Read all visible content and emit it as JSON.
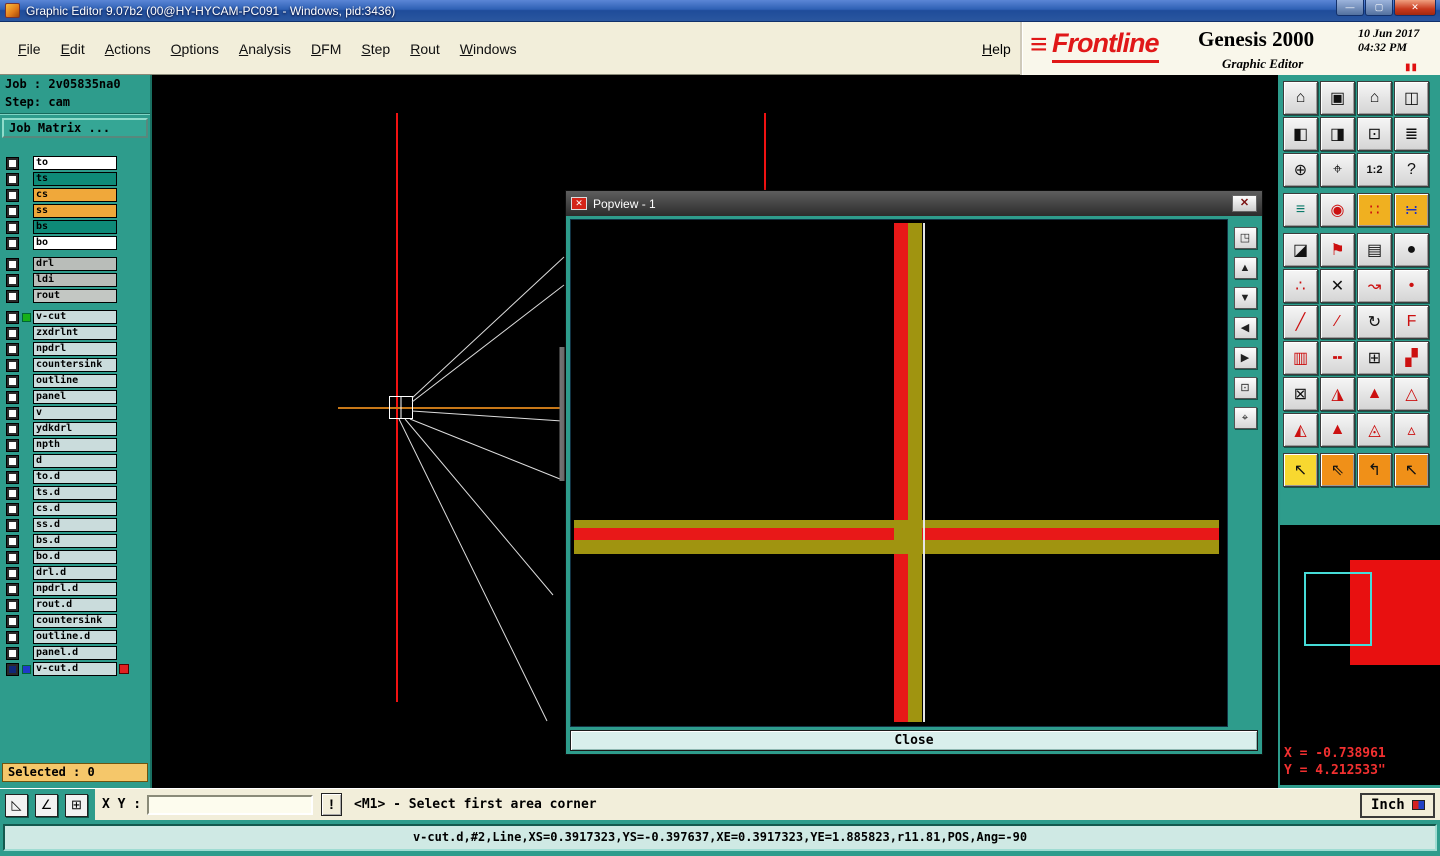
{
  "colors": {
    "accent_teal": "#2e9c8c",
    "canvas_red": "#f01212",
    "canvas_orange": "#c87818",
    "popview_olive": "#a09410",
    "popview_red": "#e81818",
    "coord_red": "#f23030",
    "selected_bar": "#f5c76a"
  },
  "titlebar": {
    "title": "Graphic Editor 9.07b2 (00@HY-HYCAM-PC091 - Windows, pid:3436)",
    "buttons": {
      "minimize": "—",
      "maximize": "▢",
      "close": "✕"
    }
  },
  "menubar": {
    "items": [
      "File",
      "Edit",
      "Actions",
      "Options",
      "Analysis",
      "DFM",
      "Step",
      "Rout",
      "Windows"
    ],
    "help": "Help"
  },
  "brand": {
    "logo_icon": "≡",
    "logo": "Frontline",
    "product": "Genesis 2000",
    "date": "10 Jun 2017",
    "time": "04:32 PM",
    "subtitle": "Graphic Editor",
    "pause_icon": "▮▮"
  },
  "sidebar": {
    "job": "Job : 2v05835na0",
    "step": "Step: cam",
    "job_matrix": "Job Matrix ...",
    "selected": "Selected : 0",
    "layers": [
      {
        "name": "to",
        "bg": "#ffffff"
      },
      {
        "name": "ts",
        "bg": "#0e8a78"
      },
      {
        "name": "cs",
        "bg": "#f0a83a"
      },
      {
        "name": "ss",
        "bg": "#f0a83a"
      },
      {
        "name": "bs",
        "bg": "#0e8a78"
      },
      {
        "name": "bo",
        "bg": "#ffffff"
      },
      {
        "name": "drl",
        "bg": "#b9bdb9",
        "gap": true
      },
      {
        "name": "ldi",
        "bg": "#b9bdb9"
      },
      {
        "name": "rout",
        "bg": "#c3c7c3"
      },
      {
        "name": "v-cut",
        "bg": "#cadcdc",
        "gap": true,
        "indicator": "#18b018"
      },
      {
        "name": "zxdrlnt",
        "bg": "#cadcdc"
      },
      {
        "name": "npdrl",
        "bg": "#cadcdc"
      },
      {
        "name": "countersink",
        "bg": "#cadcdc"
      },
      {
        "name": "outline",
        "bg": "#cadcdc"
      },
      {
        "name": "panel",
        "bg": "#cadcdc"
      },
      {
        "name": "v",
        "bg": "#cadcdc"
      },
      {
        "name": "ydkdrl",
        "bg": "#cadcdc"
      },
      {
        "name": "npth",
        "bg": "#cadcdc"
      },
      {
        "name": "d",
        "bg": "#cadcdc"
      },
      {
        "name": "to.d",
        "bg": "#cadcdc"
      },
      {
        "name": "ts.d",
        "bg": "#cadcdc"
      },
      {
        "name": "cs.d",
        "bg": "#cadcdc"
      },
      {
        "name": "ss.d",
        "bg": "#cadcdc"
      },
      {
        "name": "bs.d",
        "bg": "#cadcdc"
      },
      {
        "name": "bo.d",
        "bg": "#cadcdc"
      },
      {
        "name": "drl.d",
        "bg": "#cadcdc"
      },
      {
        "name": "npdrl.d",
        "bg": "#cadcdc"
      },
      {
        "name": "rout.d",
        "bg": "#cadcdc"
      },
      {
        "name": "countersink",
        "bg": "#cadcdc"
      },
      {
        "name": "outline.d",
        "bg": "#cadcdc"
      },
      {
        "name": "panel.d",
        "bg": "#cadcdc"
      },
      {
        "name": "v-cut.d",
        "bg": "#cadcdc",
        "indicator": "#2038c8",
        "right_indicator": "#e02020",
        "checkbox": "#102878"
      }
    ]
  },
  "popview": {
    "title": "Popview - 1",
    "icon_glyph": "✕",
    "close_x": "✕",
    "close_label": "Close",
    "side_buttons": [
      {
        "n": "popview-clone-icon",
        "g": "◳"
      },
      {
        "n": "pan-up-icon",
        "g": "▲"
      },
      {
        "n": "pan-down-icon",
        "g": "▼"
      },
      {
        "n": "pan-left-icon",
        "g": "◀"
      },
      {
        "n": "pan-right-icon",
        "g": "▶"
      },
      {
        "n": "zoom-window-icon",
        "g": "⊡"
      },
      {
        "n": "center-target-icon",
        "g": "⌖"
      }
    ]
  },
  "right_toolbar": {
    "rows": [
      {
        "buttons": [
          {
            "n": "new-view-icon",
            "g": "⌂"
          },
          {
            "n": "screen-icon",
            "g": "▣"
          },
          {
            "n": "home-view-icon",
            "g": "⌂"
          },
          {
            "n": "split-view-icon",
            "g": "◫"
          }
        ]
      },
      {
        "buttons": [
          {
            "n": "shift-left-icon",
            "g": "◧"
          },
          {
            "n": "shift-right-icon",
            "g": "◨"
          },
          {
            "n": "five-views-icon",
            "g": "⊡"
          },
          {
            "n": "stack-views-icon",
            "g": "≣"
          }
        ]
      },
      {
        "buttons": [
          {
            "n": "zoom-extents-icon",
            "g": "⊕"
          },
          {
            "n": "zoom-center-icon",
            "g": "⌖"
          },
          {
            "n": "zoom-ratio-icon",
            "g": "1:2"
          },
          {
            "n": "help-icon",
            "g": "?"
          }
        ]
      },
      {
        "gap": true,
        "buttons": [
          {
            "n": "measure-lines-icon",
            "g": "≡",
            "c": "#0a7a6a"
          },
          {
            "n": "pad-select-icon",
            "g": "◉",
            "c": "#cc1010"
          },
          {
            "n": "net-points-icon",
            "g": "∷",
            "c": "#cc1010",
            "b": "#f0b020"
          },
          {
            "n": "net-points-alt-icon",
            "g": "∺",
            "c": "#2030c0",
            "b": "#f0b020"
          }
        ]
      },
      {
        "gap": true,
        "buttons": [
          {
            "n": "corner-mode-icon",
            "g": "◪"
          },
          {
            "n": "flag-mode-icon",
            "g": "⚑",
            "c": "#cc1010"
          },
          {
            "n": "ruler-icon",
            "g": "▤"
          },
          {
            "n": "filled-circle-icon",
            "g": "●"
          }
        ]
      },
      {
        "buttons": [
          {
            "n": "points-pair-icon",
            "g": "∴",
            "c": "#cc1010"
          },
          {
            "n": "delete-icon",
            "g": "✕"
          },
          {
            "n": "move-vertex-icon",
            "g": "↝",
            "c": "#cc1010"
          },
          {
            "n": "single-dot-icon",
            "g": "•",
            "c": "#cc1010"
          }
        ]
      },
      {
        "buttons": [
          {
            "n": "line-45-icon",
            "g": "╱",
            "c": "#cc1010"
          },
          {
            "n": "line-any-angle-icon",
            "g": "∕",
            "c": "#cc1010"
          },
          {
            "n": "rotate-icon",
            "g": "↻"
          },
          {
            "n": "mirror-f-icon",
            "g": "F",
            "c": "#cc1010"
          }
        ]
      },
      {
        "buttons": [
          {
            "n": "hatch-icon",
            "g": "▥",
            "c": "#cc1010"
          },
          {
            "n": "short-line-icon",
            "g": "╍",
            "c": "#cc1010"
          },
          {
            "n": "transform-box-icon",
            "g": "⊞"
          },
          {
            "n": "surface-icon",
            "g": "▞",
            "c": "#cc1010"
          }
        ]
      },
      {
        "buttons": [
          {
            "n": "close-window-icon",
            "g": "⊠"
          },
          {
            "n": "triangle-up-icon",
            "g": "◮",
            "c": "#cc1010"
          },
          {
            "n": "arrow-a-icon",
            "g": "▲",
            "c": "#cc1010"
          },
          {
            "n": "arrow-a-alt-icon",
            "g": "△",
            "c": "#cc1010"
          }
        ]
      },
      {
        "buttons": [
          {
            "n": "select-peak-icon",
            "g": "◭",
            "c": "#cc1010"
          },
          {
            "n": "select-peak2-icon",
            "g": "▲",
            "c": "#cc1010"
          },
          {
            "n": "select-peak3-icon",
            "g": "◬",
            "c": "#cc1010"
          },
          {
            "n": "select-peak4-icon",
            "g": "▵",
            "c": "#cc1010"
          }
        ]
      },
      {
        "gap": true,
        "buttons": [
          {
            "n": "pointer-icon",
            "g": "↖",
            "b": "#f8d830"
          },
          {
            "n": "pointer-select-icon",
            "g": "⇖",
            "b": "#f09018"
          },
          {
            "n": "pointer-add-icon",
            "g": "↰",
            "b": "#f09018"
          },
          {
            "n": "pointer-rotate-icon",
            "g": "↖",
            "b": "#f09018"
          }
        ]
      }
    ]
  },
  "coords": {
    "x": "X = -0.738961",
    "y": "Y = 4.212533\""
  },
  "bottombar": {
    "tools": [
      {
        "n": "corner-tool-icon",
        "g": "◺"
      },
      {
        "n": "angle-tool-icon",
        "g": "∠"
      },
      {
        "n": "grid-tool-icon",
        "g": "⊞"
      }
    ],
    "xy_label": "X Y :",
    "input_value": "",
    "alert": "!",
    "message": "<M1> - Select first area corner",
    "units": "Inch"
  },
  "statusbar": {
    "text": "v-cut.d,#2,Line,XS=0.3917323,YS=-0.397637,XE=0.3917323,YE=1.885823,r11.81,POS,Ang=-90"
  }
}
